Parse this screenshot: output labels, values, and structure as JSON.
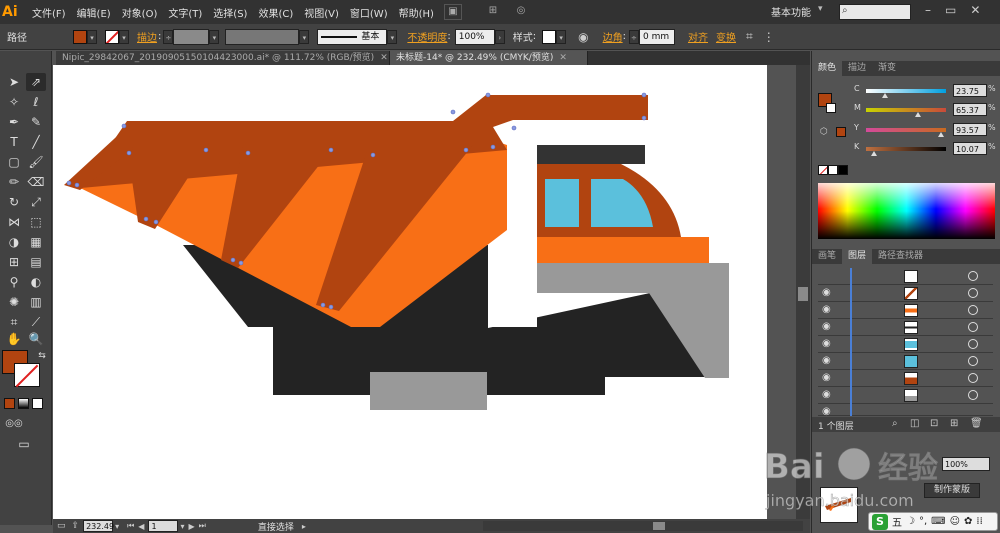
{
  "app": {
    "logo": "Ai",
    "menu": [
      "文件(F)",
      "编辑(E)",
      "对象(O)",
      "文字(T)",
      "选择(S)",
      "效果(C)",
      "视图(V)",
      "窗口(W)",
      "帮助(H)"
    ],
    "workspace": "基本功能",
    "colors": {
      "fill": "#b14410",
      "accent": "#f0a020"
    }
  },
  "controlbar": {
    "path_label": "路径",
    "stroke_label": "描边",
    "stroke_style": "基本",
    "opacity_label": "不透明度",
    "opacity_value": "100%",
    "style_label": "样式",
    "corner_label": "边角",
    "corner_value": "0 mm",
    "align_label": "对齐",
    "transform_label": "变换"
  },
  "tabs": [
    {
      "label": "Nipic_29842067_20190905150104423000.ai* @ 111.72% (RGB/预览)",
      "active": false
    },
    {
      "label": "未标题-14* @ 232.49% (CMYK/预览)",
      "active": true
    }
  ],
  "color_panel": {
    "tabs": [
      "颜色",
      "描边",
      "渐变"
    ],
    "channels": [
      {
        "name": "C",
        "value": "23.75",
        "fraction": 0.24,
        "from": "#ffffff",
        "to": "#00a0e0"
      },
      {
        "name": "M",
        "value": "65.37",
        "fraction": 0.65,
        "from": "#c8d200",
        "to": "#c84a3a"
      },
      {
        "name": "Y",
        "value": "93.57",
        "fraction": 0.94,
        "from": "#d44a9a",
        "to": "#c86a20"
      },
      {
        "name": "K",
        "value": "10.07",
        "fraction": 0.1,
        "from": "#c07040",
        "to": "#000000"
      }
    ],
    "pct": "%"
  },
  "layers_panel": {
    "tabs": [
      "画笔",
      "图层",
      "路径查找器"
    ],
    "count": "1 个图层",
    "opacity_value": "100%",
    "mask_button": "制作蒙版"
  },
  "status": {
    "zoom": "232.49",
    "page": "1",
    "tool": "直接选择"
  },
  "watermark": {
    "brand": "Bai",
    "brand2": "经验",
    "url": "jingyan.baidu.com"
  },
  "ime": {
    "logo": "S",
    "mode": "五"
  }
}
